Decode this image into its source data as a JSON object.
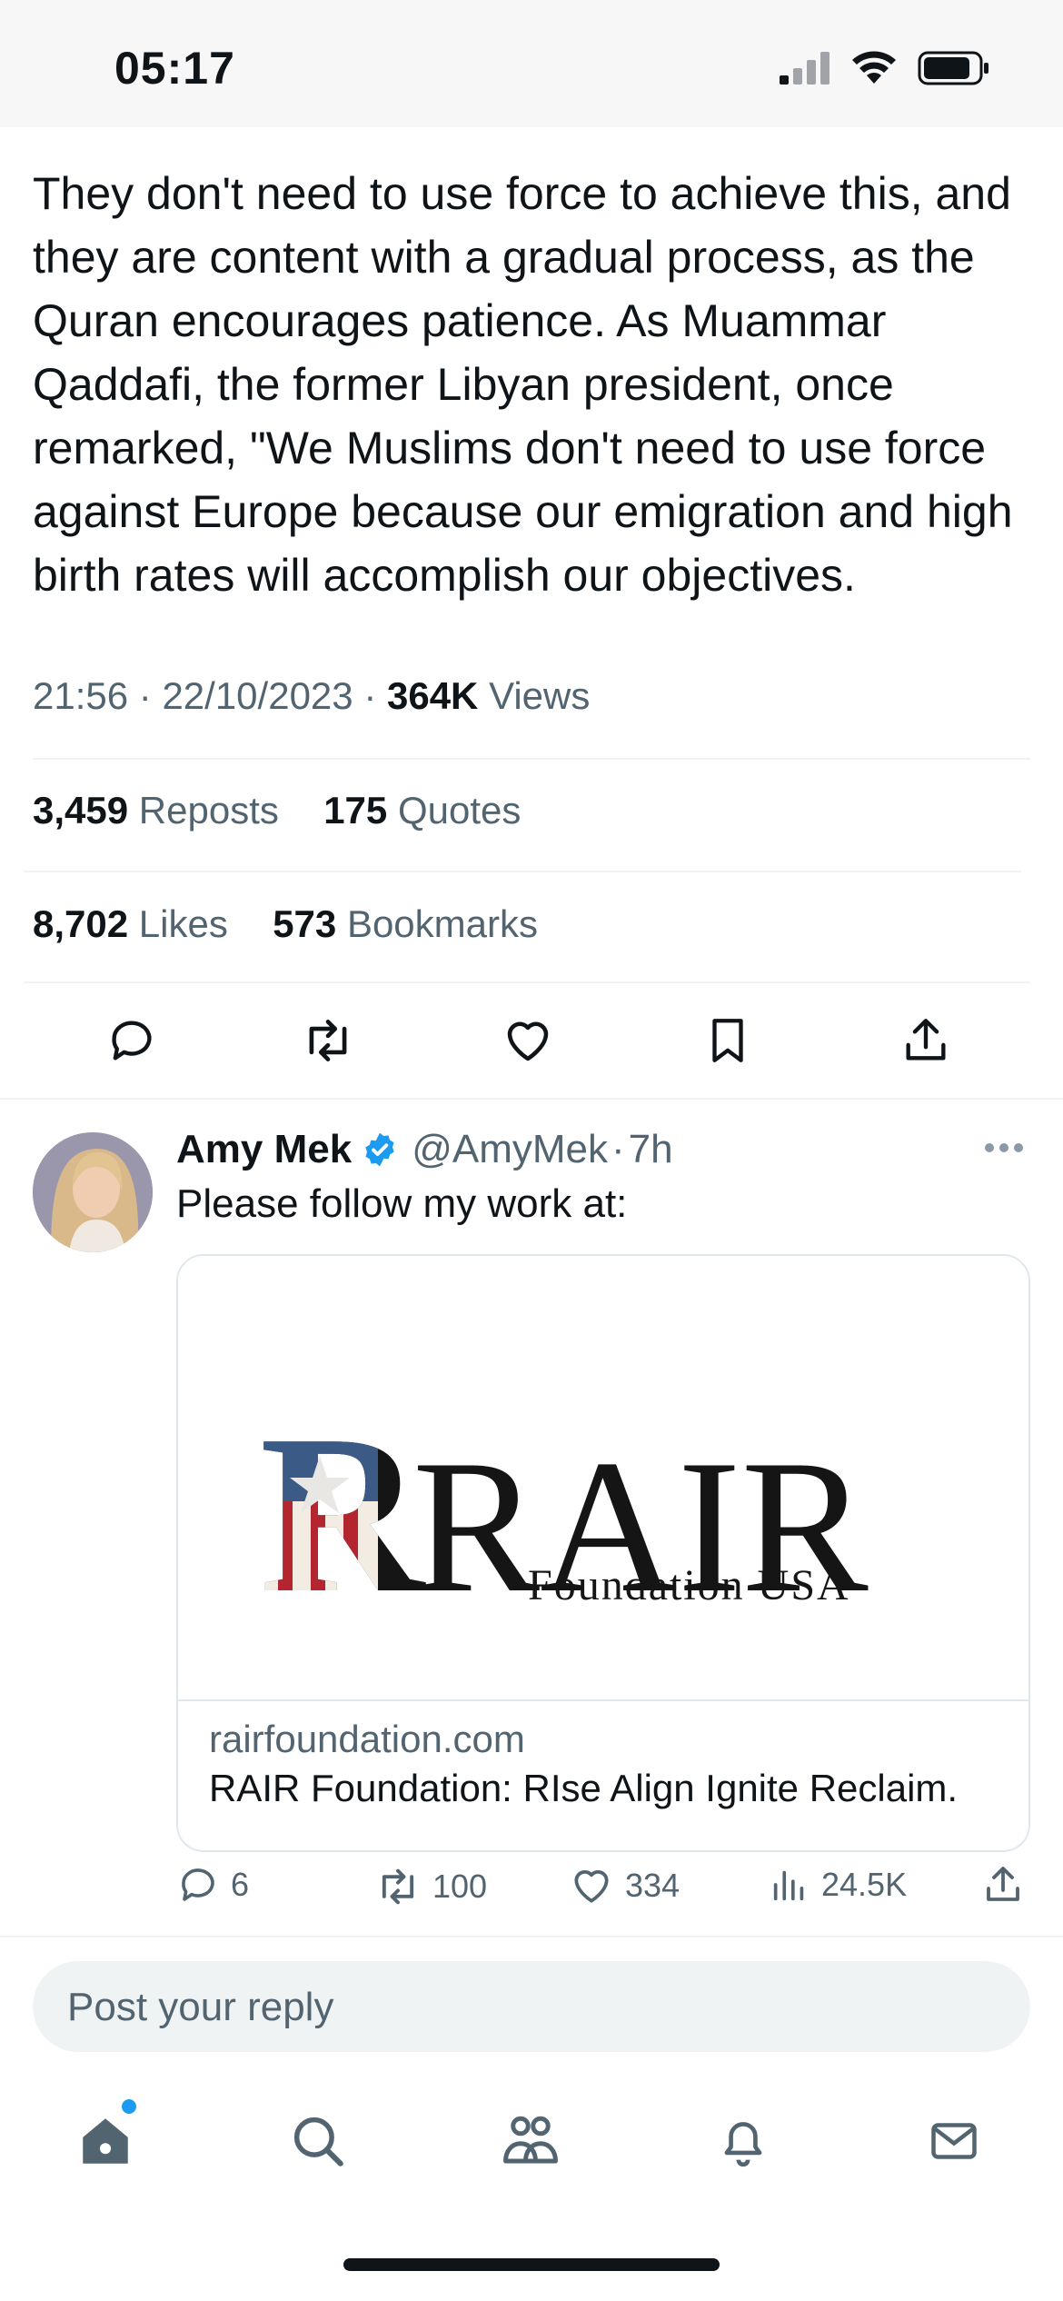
{
  "status_bar": {
    "time": "05:17"
  },
  "tweet": {
    "text": "They don't need to use force to achieve this, and they are content with a gradual process, as the Quran encourages patience. As Muammar Qaddafi, the former Libyan president, once remarked, \"We Muslims don't need to use force against Europe because our emigration and high birth rates will accomplish our objectives.",
    "time": "21:56",
    "date": "22/10/2023",
    "views_count": "364K",
    "views_label": "Views",
    "reposts_count": "3,459",
    "reposts_label": "Reposts",
    "quotes_count": "175",
    "quotes_label": "Quotes",
    "likes_count": "8,702",
    "likes_label": "Likes",
    "bookmarks_count": "573",
    "bookmarks_label": "Bookmarks"
  },
  "reply": {
    "name": "Amy Mek",
    "handle": "@AmyMek",
    "age": "7h",
    "body": "Please follow my work at:",
    "card": {
      "logo_text": "RAIR",
      "logo_subtext": "Foundation USA",
      "domain": "rairfoundation.com",
      "title": "RAIR Foundation: RIse Align Ignite Reclaim."
    },
    "replies": "6",
    "reposts": "100",
    "likes": "334",
    "views": "24.5K"
  },
  "reply_box": {
    "placeholder": "Post your reply"
  },
  "colors": {
    "accent": "#1d9bf0",
    "muted": "#536471",
    "text": "#0f1419"
  },
  "icons": {
    "status": [
      "signal-icon",
      "wifi-icon",
      "battery-icon"
    ],
    "tweet_actions": [
      "reply-icon",
      "repost-icon",
      "like-icon",
      "bookmark-icon",
      "share-icon"
    ],
    "tabs": [
      "home-icon",
      "search-icon",
      "communities-icon",
      "notifications-icon",
      "messages-icon"
    ]
  }
}
